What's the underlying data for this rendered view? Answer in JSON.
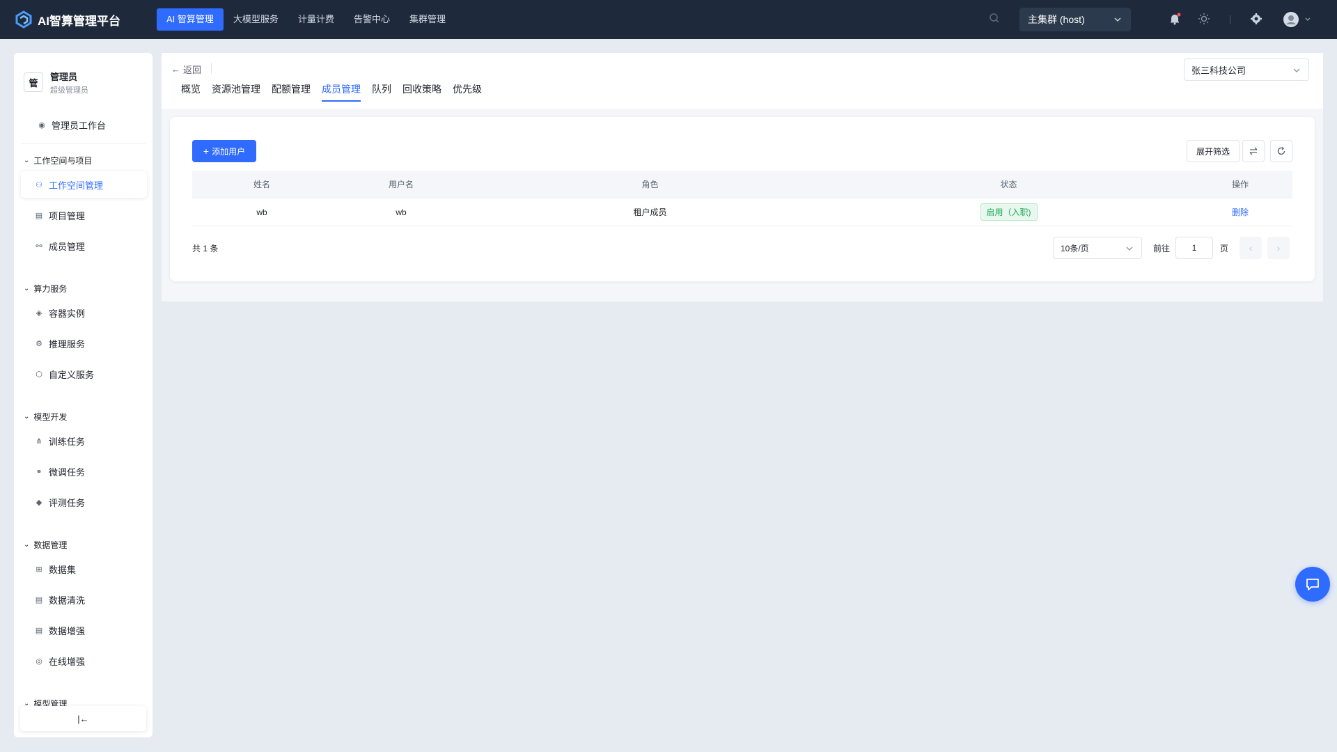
{
  "app": {
    "title": "AI智算管理平台",
    "accent_color": "#2f6bff",
    "topbar_color": "#1e2a3b"
  },
  "topnav": {
    "items": [
      {
        "label": "AI 智算管理",
        "active": true
      },
      {
        "label": "大模型服务",
        "active": false
      },
      {
        "label": "计量计费",
        "active": false
      },
      {
        "label": "告警中心",
        "active": false
      },
      {
        "label": "集群管理",
        "active": false
      }
    ],
    "cluster_select": "主集群 (host)",
    "icons": [
      "search-icon",
      "bell-icon",
      "sun-icon",
      "gear-icon",
      "user-avatar-icon"
    ]
  },
  "sidebar": {
    "user": {
      "avatar_char": "管",
      "name": "管理员",
      "role": "超级管理员"
    },
    "top_item": "管理员工作台",
    "groups": [
      {
        "title": "工作空间与项目",
        "items": [
          {
            "label": "工作空间管理",
            "active": true
          },
          {
            "label": "项目管理",
            "active": false
          },
          {
            "label": "成员管理",
            "active": false
          }
        ]
      },
      {
        "title": "算力服务",
        "items": [
          {
            "label": "容器实例"
          },
          {
            "label": "推理服务"
          },
          {
            "label": "自定义服务"
          }
        ]
      },
      {
        "title": "模型开发",
        "items": [
          {
            "label": "训练任务"
          },
          {
            "label": "微调任务"
          },
          {
            "label": "评测任务"
          }
        ]
      },
      {
        "title": "数据管理",
        "items": [
          {
            "label": "数据集"
          },
          {
            "label": "数据清洗"
          },
          {
            "label": "数据增强"
          },
          {
            "label": "在线增强"
          }
        ]
      },
      {
        "title": "模型管理",
        "items": []
      }
    ],
    "collapse_label": "|←"
  },
  "header": {
    "back_label": "返回",
    "company_select": "张三科技公司",
    "tabs": [
      {
        "label": "概览",
        "active": false
      },
      {
        "label": "资源池管理",
        "active": false
      },
      {
        "label": "配额管理",
        "active": false
      },
      {
        "label": "成员管理",
        "active": true
      },
      {
        "label": "队列",
        "active": false
      },
      {
        "label": "回收策略",
        "active": false
      },
      {
        "label": "优先级",
        "active": false
      }
    ]
  },
  "toolbar": {
    "add_user_label": "添加用户",
    "filter_label": "展开筛选"
  },
  "table": {
    "columns": [
      "姓名",
      "用户名",
      "角色",
      "状态",
      "操作"
    ],
    "rows": [
      {
        "name": "wb",
        "username": "wb",
        "role": "租户成员",
        "status": "启用（入职)",
        "action": "删除"
      }
    ]
  },
  "pagination": {
    "total_label": "共 1 条",
    "page_size": "10条/页",
    "goto_label": "前往",
    "current_page": "1",
    "page_unit": "页"
  }
}
